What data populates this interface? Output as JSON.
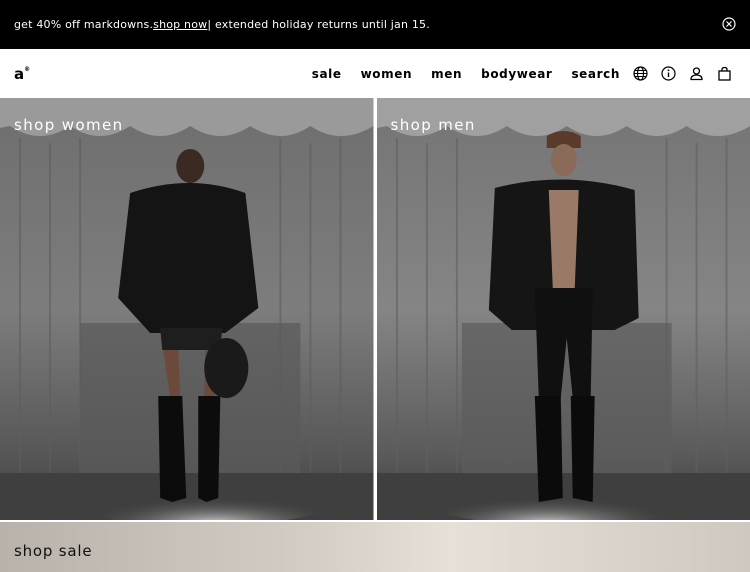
{
  "promo": {
    "text_before": "get 40% off markdowns. ",
    "link_text": "shop now",
    "text_after": " | extended holiday returns until jan 15."
  },
  "header": {
    "logo": "a",
    "nav": [
      "sale",
      "women",
      "men",
      "bodywear",
      "search"
    ],
    "icons": [
      "globe-icon",
      "info-icon",
      "account-icon",
      "bag-icon"
    ]
  },
  "hero": {
    "women_label": "shop women",
    "men_label": "shop men"
  },
  "sale_banner": {
    "label": "shop sale"
  },
  "colors": {
    "promo_bg": "#000000",
    "text_dark": "#000000",
    "text_light": "#ffffff"
  }
}
